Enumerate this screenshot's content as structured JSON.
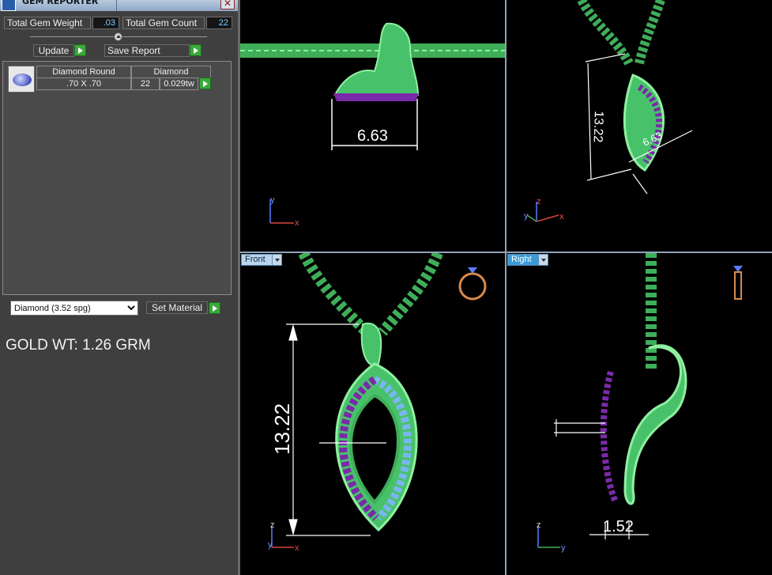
{
  "window": {
    "title": "GEM REPORTER"
  },
  "summary": {
    "total_weight_label": "Total Gem Weight",
    "total_weight_value": ".03",
    "total_count_label": "Total Gem Count",
    "total_count_value": "22"
  },
  "actions": {
    "update_label": "Update",
    "save_report_label": "Save Report",
    "set_material_label": "Set Material"
  },
  "gems": [
    {
      "name": "Diamond Round",
      "size": ".70 X .70",
      "type": "Diamond",
      "count": "22",
      "weight": "0.029tw"
    }
  ],
  "material": {
    "selected": "Diamond    (3.52 spg)"
  },
  "gold_weight": "GOLD WT: 1.26 GRM",
  "viewports": {
    "top": {
      "dimension": "6.63"
    },
    "perspective": {
      "dimension_height": "13.22",
      "dimension_width": "6.63",
      "dimension_small": "1.52"
    },
    "front": {
      "label": "Front",
      "dimension": "13.22"
    },
    "right": {
      "label": "Right",
      "dimension": "1.52"
    }
  },
  "axes": {
    "x": "x",
    "y": "y",
    "z": "z"
  },
  "colors": {
    "metal": "#4ccf5a",
    "gem_purple": "#7a2aa8",
    "gem_blue": "#7ab6f0",
    "dimension": "#ffffff"
  }
}
